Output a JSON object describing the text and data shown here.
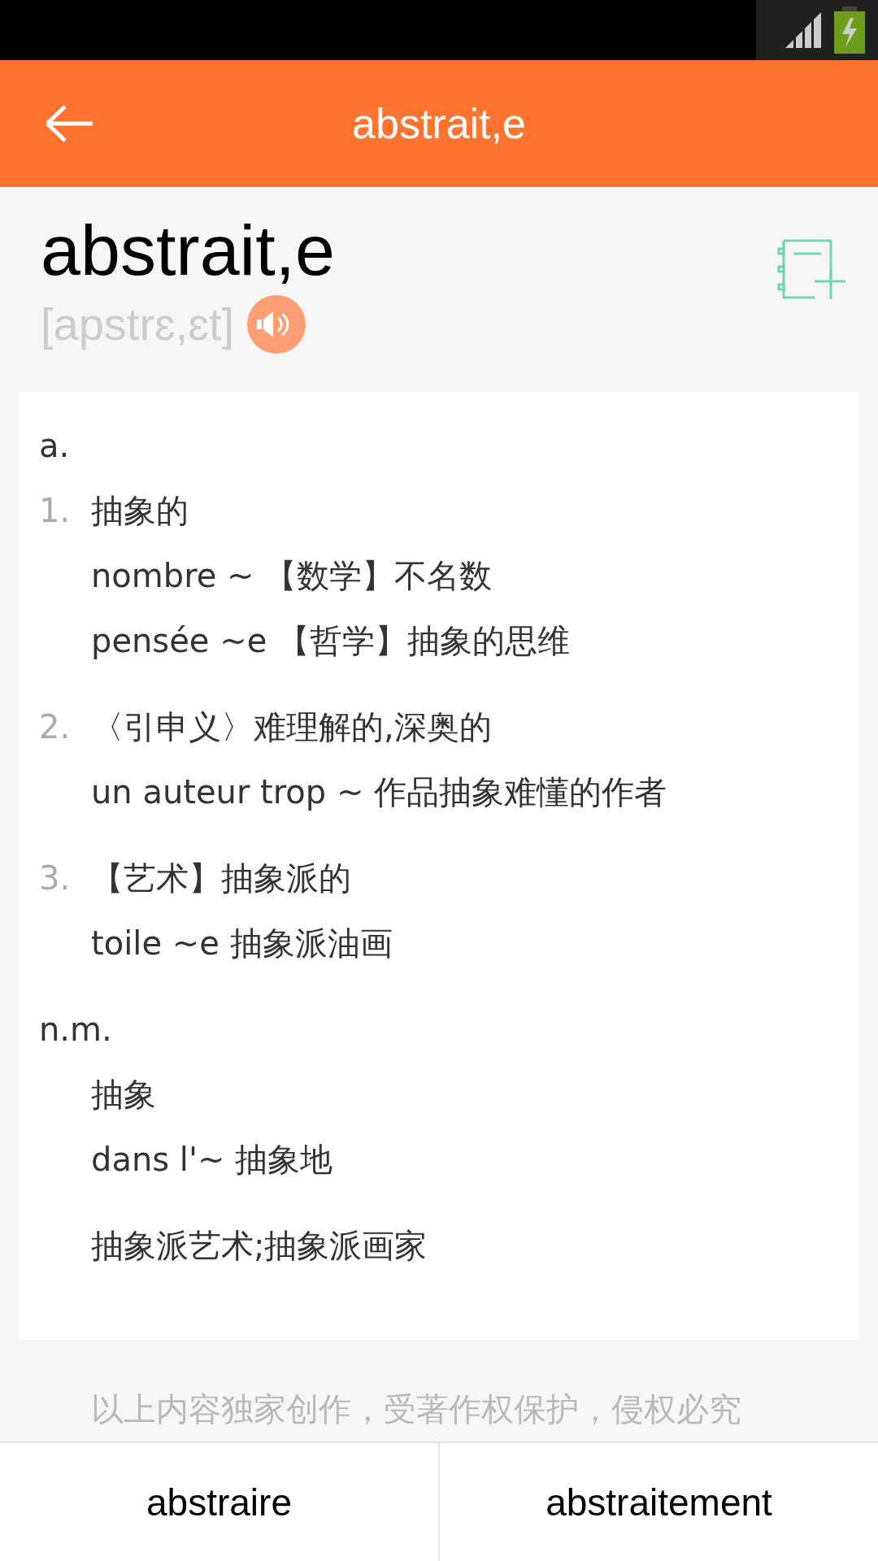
{
  "app_bar": {
    "title": "abstrait,e"
  },
  "headword": "abstrait,e",
  "phonetic": "[apstrɛ,ɛt]",
  "entries": [
    {
      "pos": "a.",
      "senses": [
        {
          "number": "1.",
          "lines": [
            "抽象的",
            "nombre ~ 【数学】不名数",
            "pensée ~e 【哲学】抽象的思维"
          ]
        },
        {
          "number": "2.",
          "lines": [
            "〈引申义〉难理解的,深奥的",
            "un auteur trop ~ 作品抽象难懂的作者"
          ]
        },
        {
          "number": "3.",
          "lines": [
            "【艺术】抽象派的",
            "toile ~e 抽象派油画"
          ]
        }
      ]
    },
    {
      "pos": "n.m.",
      "senses": [
        {
          "lines": [
            "抽象",
            "dans l'~ 抽象地"
          ]
        },
        {
          "lines": [
            "抽象派艺术;抽象派画家"
          ]
        }
      ]
    }
  ],
  "copyright": "以上内容独家创作，受著作权保护，侵权必究",
  "bottom_nav": [
    {
      "label": "abstraire"
    },
    {
      "label": "abstraitement"
    }
  ]
}
